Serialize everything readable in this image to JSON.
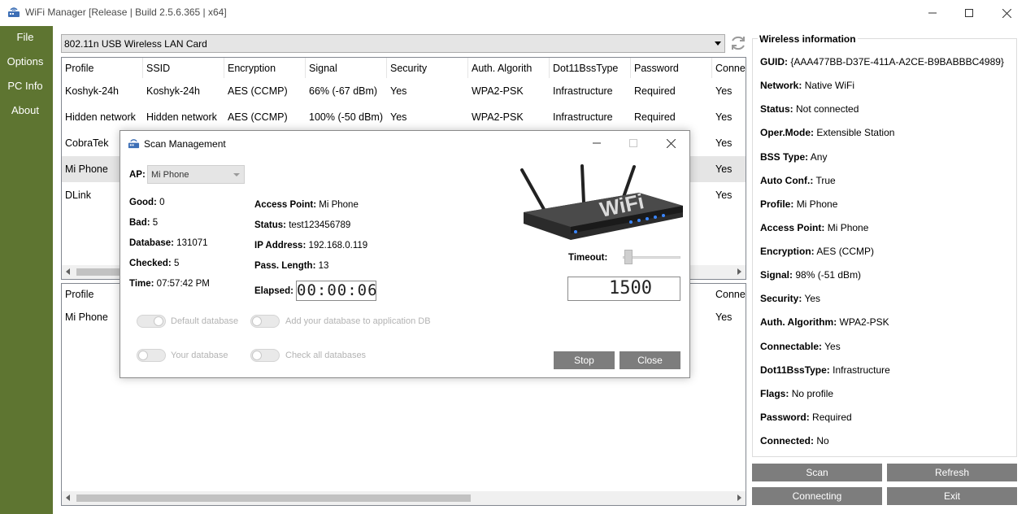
{
  "window": {
    "title": "WiFi Manager [Release | Build 2.5.6.365 | x64]",
    "icons": [
      "app-icon",
      "minimize-icon",
      "maximize-icon",
      "close-icon"
    ]
  },
  "sidebar": {
    "items": [
      {
        "label": "File"
      },
      {
        "label": "Options"
      },
      {
        "label": "PC Info"
      },
      {
        "label": "About"
      }
    ]
  },
  "adapter": {
    "selected": "802.11n USB Wireless LAN Card"
  },
  "networks": {
    "columns": [
      "Profile",
      "SSID",
      "Encryption",
      "Signal",
      "Security",
      "Auth. Algorith",
      "Dot11BssType",
      "Password",
      "Connec"
    ],
    "rows": [
      [
        "Koshyk-24h",
        "Koshyk-24h",
        "AES (CCMP)",
        "66% (-67 dBm)",
        "Yes",
        "WPA2-PSK",
        "Infrastructure",
        "Required",
        "Yes"
      ],
      [
        "Hidden network",
        "Hidden network",
        "AES (CCMP)",
        "100% (-50 dBm)",
        "Yes",
        "WPA2-PSK",
        "Infrastructure",
        "Required",
        "Yes"
      ],
      [
        "CobraTek",
        "",
        "",
        "",
        "",
        "",
        "",
        "",
        "Yes"
      ],
      [
        "Mi Phone",
        "",
        "",
        "",
        "",
        "",
        "",
        "",
        "Yes"
      ],
      [
        "DLink",
        "",
        "",
        "",
        "",
        "",
        "",
        "",
        "Yes"
      ]
    ],
    "selected_row": 3
  },
  "profiles": {
    "columns": [
      "Profile",
      "Connec"
    ],
    "rows": [
      [
        "Mi Phone",
        "Yes"
      ]
    ]
  },
  "wireless_info": {
    "title": "Wireless information",
    "lines": [
      {
        "label": "GUID:",
        "value": "{AAA477BB-D37E-411A-A2CE-B9BABBBC4989}"
      },
      {
        "label": "Network:",
        "value": "Native WiFi"
      },
      {
        "label": "Status:",
        "value": "Not connected"
      },
      {
        "label": "Oper.Mode:",
        "value": "Extensible Station"
      },
      {
        "label": "BSS Type:",
        "value": "Any"
      },
      {
        "label": "Auto Conf.:",
        "value": "True"
      },
      {
        "label": "Profile:",
        "value": "Mi Phone"
      },
      {
        "label": "Access Point:",
        "value": "Mi Phone"
      },
      {
        "label": "Encryption:",
        "value": "AES (CCMP)"
      },
      {
        "label": "Signal:",
        "value": "98% (-51 dBm)"
      },
      {
        "label": "Security:",
        "value": "Yes"
      },
      {
        "label": "Auth. Algorithm:",
        "value": "WPA2-PSK"
      },
      {
        "label": "Connectable:",
        "value": "Yes"
      },
      {
        "label": "Dot11BssType:",
        "value": "Infrastructure"
      },
      {
        "label": "Flags:",
        "value": "No profile"
      },
      {
        "label": "Password:",
        "value": "Required"
      },
      {
        "label": "Connected:",
        "value": "No"
      }
    ]
  },
  "actions": {
    "scan": "Scan",
    "refresh": "Refresh",
    "connecting": "Connecting",
    "exit": "Exit"
  },
  "dialog": {
    "title": "Scan Management",
    "ap_label": "AP:",
    "ap_value": "Mi Phone",
    "good_label": "Good:",
    "good_value": "0",
    "bad_label": "Bad:",
    "bad_value": "5",
    "database_label": "Database:",
    "database_value": "131071",
    "checked_label": "Checked:",
    "checked_value": "5",
    "time_label": "Time:",
    "time_value": "07:57:42 PM",
    "access_point_label": "Access Point:",
    "access_point_value": "Mi Phone",
    "status_label": "Status:",
    "status_value": "test123456789",
    "ip_label": "IP Address:",
    "ip_value": "192.168.0.119",
    "pass_length_label": "Pass. Length:",
    "pass_length_value": "13",
    "elapsed_label": "Elapsed:",
    "elapsed_value": "00:00:06",
    "timeout_label": "Timeout:",
    "timeout_value": "1500",
    "toggles": {
      "default_db": "Default database",
      "add_db": "Add your database to application DB",
      "your_db": "Your database",
      "check_all": "Check all databases"
    },
    "stop": "Stop",
    "close": "Close",
    "router_text": "WiFi"
  },
  "colors": {
    "sidebar": "#5e7531",
    "button": "#7d7d7d",
    "selected_row": "#e5e5e5"
  }
}
